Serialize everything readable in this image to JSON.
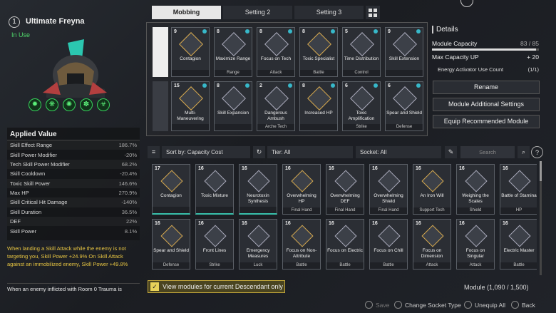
{
  "character": {
    "slot": "1",
    "name": "Ultimate Freyna",
    "status": "In Use"
  },
  "skill_icons": [
    "skill-1-icon",
    "skill-2-icon",
    "skill-3-icon",
    "skill-4-icon",
    "biohazard-icon"
  ],
  "applied": {
    "title": "Applied Value",
    "stats": [
      {
        "label": "Skill Effect Range",
        "value": "186.7%"
      },
      {
        "label": "Skill Power Modifier",
        "value": "-20%"
      },
      {
        "label": "Tech Skill Power Modifier",
        "value": "68.2%"
      },
      {
        "label": "Skill Cooldown",
        "value": "-20.4%"
      },
      {
        "label": "Toxic Skill Power",
        "value": "146.6%"
      },
      {
        "label": "Max HP",
        "value": "270.9%"
      },
      {
        "label": "Skill Critical Hit Damage",
        "value": "-140%"
      },
      {
        "label": "Skill Duration",
        "value": "36.5%"
      },
      {
        "label": "DEF",
        "value": "22%"
      },
      {
        "label": "Skill Power",
        "value": "8.1%"
      }
    ],
    "effect_text": "When landing a Skill Attack while the enemy is not targeting you, Skill Power +24.9% On Skill Attack against an immobilized enemy, Skill Power +49.8%",
    "effect_text2": "When an enemy inflicted with Room 0 Trauma is"
  },
  "tabs": [
    "Mobbing",
    "Setting 2",
    "Setting 3"
  ],
  "equipped_row1": [
    {
      "cost": "9",
      "name": "Contagion",
      "cat": ""
    },
    {
      "cost": "8",
      "name": "Maximize Range",
      "cat": "Range"
    },
    {
      "cost": "8",
      "name": "Focus on Tech",
      "cat": "Attack"
    },
    {
      "cost": "8",
      "name": "Toxic Specialist",
      "cat": "Battle"
    },
    {
      "cost": "5",
      "name": "Time Distribution",
      "cat": "Control"
    },
    {
      "cost": "9",
      "name": "Skill Extension",
      "cat": ""
    }
  ],
  "equipped_row2": [
    {
      "cost": "15",
      "name": "Multi-Maneuvering",
      "cat": ""
    },
    {
      "cost": "8",
      "name": "Skill Expansion",
      "cat": ""
    },
    {
      "cost": "2",
      "name": "Dangerous Ambush",
      "cat": "Arche Tech"
    },
    {
      "cost": "8",
      "name": "Increased HP",
      "cat": ""
    },
    {
      "cost": "6",
      "name": "Toxic Amplification",
      "cat": "Strike"
    },
    {
      "cost": "6",
      "name": "Spear and Shield",
      "cat": "Defense"
    }
  ],
  "details": {
    "title": "Details",
    "capacity_label": "Module Capacity",
    "capacity_value": "83 / 85",
    "capacity_fraction": 0.976,
    "maxcap_label": "Max Capacity UP",
    "maxcap_value": "+ 20",
    "energy_label": "Energy Activator Use Count",
    "energy_value": "(1/1)"
  },
  "buttons": {
    "rename": "Rename",
    "additional": "Module Additional Settings",
    "recommended": "Equip Recommended Module"
  },
  "filters": {
    "sort": "Sort by: Capacity Cost",
    "tier": "Tier: All",
    "socket": "Socket: All",
    "search_placeholder": "Search"
  },
  "inventory_row1": [
    {
      "cost": "17",
      "name": "Contagion",
      "cat": "",
      "teal": true
    },
    {
      "cost": "16",
      "name": "Toxic Mixture",
      "cat": "",
      "teal": true
    },
    {
      "cost": "16",
      "name": "Neurotoxin Synthesis",
      "cat": "",
      "teal": true
    },
    {
      "cost": "16",
      "name": "Overwhelming HP",
      "cat": "Final Hand"
    },
    {
      "cost": "16",
      "name": "Overwhelming DEF",
      "cat": "Final Hand"
    },
    {
      "cost": "16",
      "name": "Overwhelming Shield",
      "cat": "Final Hand"
    },
    {
      "cost": "16",
      "name": "An Iron Will",
      "cat": "Support Tech"
    },
    {
      "cost": "16",
      "name": "Weighing the Scales",
      "cat": "Shield"
    },
    {
      "cost": "16",
      "name": "Battle of Stamina",
      "cat": "HP"
    }
  ],
  "inventory_row2": [
    {
      "cost": "16",
      "name": "Spear and Shield",
      "cat": "Defense"
    },
    {
      "cost": "16",
      "name": "Front Lines",
      "cat": "Strike"
    },
    {
      "cost": "16",
      "name": "Emergency Measures",
      "cat": "Luck"
    },
    {
      "cost": "16",
      "name": "Focus on Non-Attribute",
      "cat": "Battle"
    },
    {
      "cost": "16",
      "name": "Focus on Electric",
      "cat": "Battle"
    },
    {
      "cost": "16",
      "name": "Focus on Chill",
      "cat": "Battle"
    },
    {
      "cost": "16",
      "name": "Focus on Dimension",
      "cat": "Attack"
    },
    {
      "cost": "16",
      "name": "Focus on Singular",
      "cat": "Attack"
    },
    {
      "cost": "16",
      "name": "Electric Master",
      "cat": "Battle"
    }
  ],
  "bottom": {
    "view_only": "View modules for current Descendant only",
    "module_count": "Module (1,090 / 1,500)"
  },
  "footer": {
    "save": "Save",
    "change_socket": "Change Socket Type",
    "unequip": "Unequip All",
    "back": "Back"
  }
}
